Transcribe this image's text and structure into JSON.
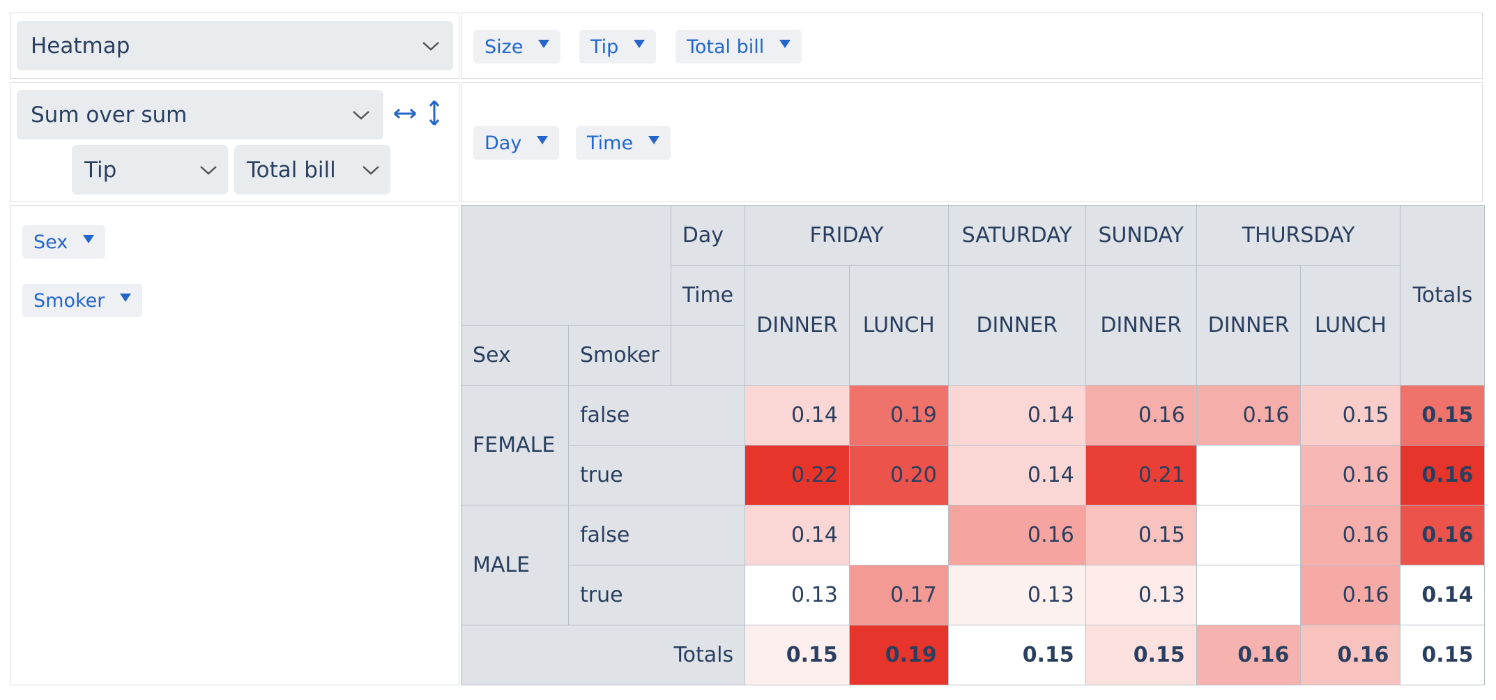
{
  "renderer": {
    "selected": "Heatmap"
  },
  "unused_attrs": [
    {
      "id": "size",
      "label": "Size"
    },
    {
      "id": "tip",
      "label": "Tip"
    },
    {
      "id": "total-bill",
      "label": "Total bill"
    }
  ],
  "aggregator": {
    "selected": "Sum over sum",
    "arg1": "Tip",
    "arg2": "Total bill"
  },
  "col_attrs": [
    {
      "id": "day",
      "label": "Day"
    },
    {
      "id": "time",
      "label": "Time"
    }
  ],
  "row_attrs": [
    {
      "id": "sex",
      "label": "Sex"
    },
    {
      "id": "smoker",
      "label": "Smoker"
    }
  ],
  "table": {
    "col_attr_labels": [
      "Day",
      "Time"
    ],
    "row_attr_labels": [
      "Sex",
      "Smoker"
    ],
    "totals_label": "Totals",
    "days": [
      {
        "label": "FRIDAY",
        "span": 2
      },
      {
        "label": "SATURDAY",
        "span": 1
      },
      {
        "label": "SUNDAY",
        "span": 1
      },
      {
        "label": "THURSDAY",
        "span": 2
      }
    ],
    "times": [
      "DINNER",
      "LUNCH",
      "DINNER",
      "DINNER",
      "DINNER",
      "LUNCH"
    ],
    "row_groups": [
      {
        "label": "FEMALE",
        "rows": [
          {
            "label": "false",
            "cells": [
              "0.14",
              "0.19",
              "0.14",
              "0.16",
              "0.16",
              "0.15"
            ],
            "heat": [
              0.2,
              0.7,
              0.2,
              0.4,
              0.4,
              0.25
            ],
            "total": "0.15",
            "total_heat": 0.7
          },
          {
            "label": "true",
            "cells": [
              "0.22",
              "0.20",
              "0.14",
              "0.21",
              "",
              "0.16"
            ],
            "heat": [
              1.0,
              0.85,
              0.2,
              0.95,
              0,
              0.35
            ],
            "total": "0.16",
            "total_heat": 1.0
          }
        ]
      },
      {
        "label": "MALE",
        "rows": [
          {
            "label": "false",
            "cells": [
              "0.14",
              "",
              "0.16",
              "0.15",
              "",
              "0.16"
            ],
            "heat": [
              0.2,
              0,
              0.45,
              0.3,
              0,
              0.4
            ],
            "total": "0.16",
            "total_heat": 0.85
          },
          {
            "label": "true",
            "cells": [
              "0.13",
              "0.17",
              "0.13",
              "0.13",
              "",
              "0.16"
            ],
            "heat": [
              0,
              0.5,
              0.07,
              0.1,
              0,
              0.42
            ],
            "total": "0.14",
            "total_heat": 0
          }
        ]
      }
    ],
    "col_totals": [
      "0.15",
      "0.19",
      "0.15",
      "0.15",
      "0.16",
      "0.16"
    ],
    "col_totals_heat": [
      0.08,
      1.0,
      0,
      0.15,
      0.38,
      0.3
    ],
    "grand_total": "0.15"
  },
  "colors": {
    "text": "#2a3f5f",
    "accent": "#2266cc",
    "header_bg": "#dfe2e7",
    "heat_max": "#e8352b",
    "border": "#dadde2"
  }
}
